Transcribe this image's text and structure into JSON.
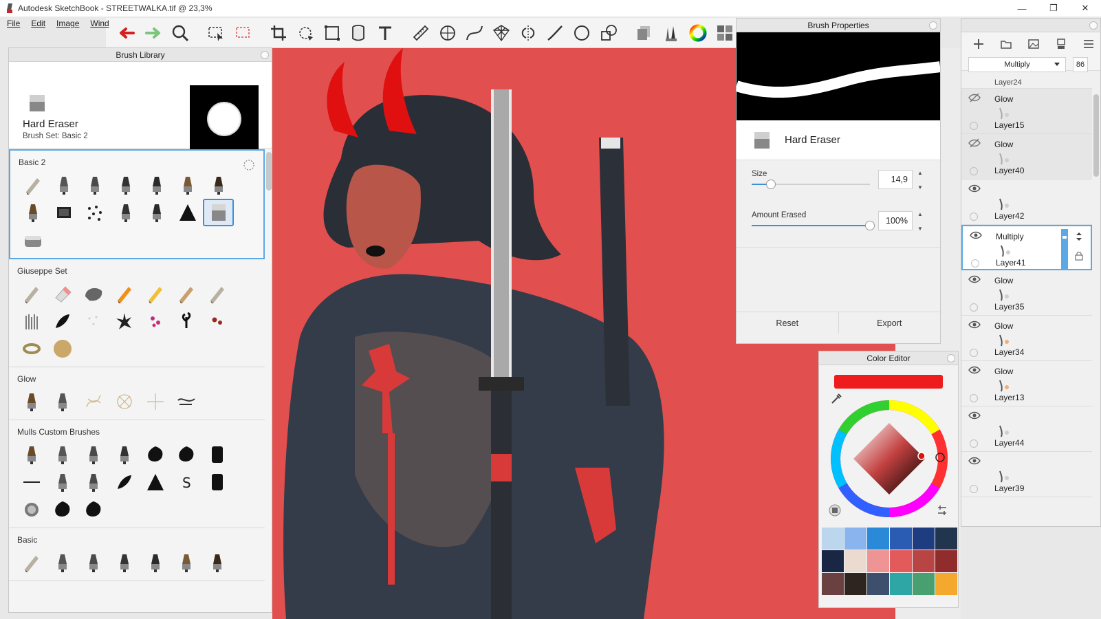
{
  "window": {
    "title": "Autodesk SketchBook - STREETWALKA.tif @ 23,3%",
    "controls": [
      "—",
      "❐",
      "✕"
    ]
  },
  "menu": [
    {
      "label": "File",
      "key": "F"
    },
    {
      "label": "Edit",
      "key": "E"
    },
    {
      "label": "Image",
      "key": "I"
    },
    {
      "label": "Wind",
      "key": "W"
    }
  ],
  "toolbar": {
    "tools": [
      "undo-icon",
      "redo-icon",
      "zoom-icon",
      "select-icon",
      "lasso-select-icon",
      "crop-icon",
      "transform-icon",
      "distort-icon",
      "bucket-icon",
      "text-icon",
      "ruler-icon",
      "ellipse-guide-icon",
      "curve-icon",
      "perspective-icon",
      "symmetry-icon",
      "stroke-icon",
      "circle-icon",
      "shapes-icon",
      "copy-paste-icon",
      "brushes-icon",
      "color-wheel-icon",
      "panels-icon"
    ]
  },
  "brush_library": {
    "title": "Brush Library",
    "current_brush": "Hard Eraser",
    "current_set": "Brush Set: Basic 2",
    "sets": [
      {
        "name": "Basic 2",
        "active": true,
        "brushes": [
          "pencil",
          "marker",
          "airbrush",
          "pen",
          "fountain-pen",
          "ink-brush",
          "brush",
          "paint-brush",
          "texture",
          "spray",
          "chisel",
          "felt-pen",
          "triangle",
          "hard-eraser",
          "soft-eraser"
        ],
        "selected": 13
      },
      {
        "name": "Giuseppe Set",
        "active": false,
        "brushes": [
          "pencil-wood",
          "eraser-pink",
          "stone",
          "orange-pencil",
          "yellow-pencil",
          "tan-pencil",
          "thin-pencil",
          "grass",
          "feather",
          "dots",
          "leaf-spray",
          "pink-flowers",
          "dark-leaves",
          "red-dots",
          "ring",
          "sponge"
        ]
      },
      {
        "name": "Glow",
        "active": false,
        "brushes": [
          "glow-airbrush",
          "glow-marker",
          "glow-scribble",
          "glow-spiral",
          "glow-sparkle",
          "glow-wave"
        ]
      },
      {
        "name": "Mulls Custom Brushes",
        "active": false,
        "brushes": [
          "flat-brush",
          "marker",
          "airbrush",
          "pen",
          "blob",
          "splat",
          "black-rect",
          "line",
          "bristle",
          "smudge",
          "feather",
          "triangle",
          "letter-s",
          "black-rect",
          "noise",
          "splat2",
          "splat3"
        ]
      },
      {
        "name": "Basic",
        "active": false,
        "brushes": [
          "pencil",
          "marker",
          "airbrush",
          "pen",
          "fountain",
          "brush",
          "fine-pen"
        ]
      }
    ]
  },
  "brush_properties": {
    "title": "Brush Properties",
    "brush_name": "Hard Eraser",
    "size_label": "Size",
    "size_value": "14,9",
    "size_fraction": 0.16,
    "amount_label": "Amount Erased",
    "amount_value": "100%",
    "amount_fraction": 1.0,
    "reset_label": "Reset",
    "export_label": "Export"
  },
  "color_editor": {
    "title": "Color Editor",
    "current_color": "#ee1c1c",
    "swatches": [
      "#bcd6ee",
      "#8ab4ee",
      "#2b8ad8",
      "#2a5cb4",
      "#1d3d80",
      "#22354f",
      "#1a2744",
      "#eadad0",
      "#ee9494",
      "#e25a5a",
      "#b84444",
      "#902c2c",
      "#6a4040",
      "#2e2420",
      "#3e4f6e",
      "#2fa6a6",
      "#48a070",
      "#f4a82e"
    ]
  },
  "layers": {
    "blend_mode": "Multiply",
    "opacity": "86",
    "items": [
      {
        "blend": "Glow",
        "name": "Layer15",
        "visible": false,
        "selected": false
      },
      {
        "blend": "Glow",
        "name": "Layer40",
        "visible": false,
        "selected": false
      },
      {
        "blend": "",
        "name": "Layer42",
        "visible": true,
        "selected": false
      },
      {
        "blend": "Multiply",
        "name": "Layer41",
        "visible": true,
        "selected": true
      },
      {
        "blend": "Glow",
        "name": "Layer35",
        "visible": true,
        "selected": false
      },
      {
        "blend": "Glow",
        "name": "Layer34",
        "visible": true,
        "selected": false
      },
      {
        "blend": "Glow",
        "name": "Layer13",
        "visible": true,
        "selected": false
      },
      {
        "blend": "",
        "name": "Layer44",
        "visible": true,
        "selected": false
      },
      {
        "blend": "",
        "name": "Layer39",
        "visible": true,
        "selected": false
      }
    ],
    "partial_top": "Layer24"
  }
}
